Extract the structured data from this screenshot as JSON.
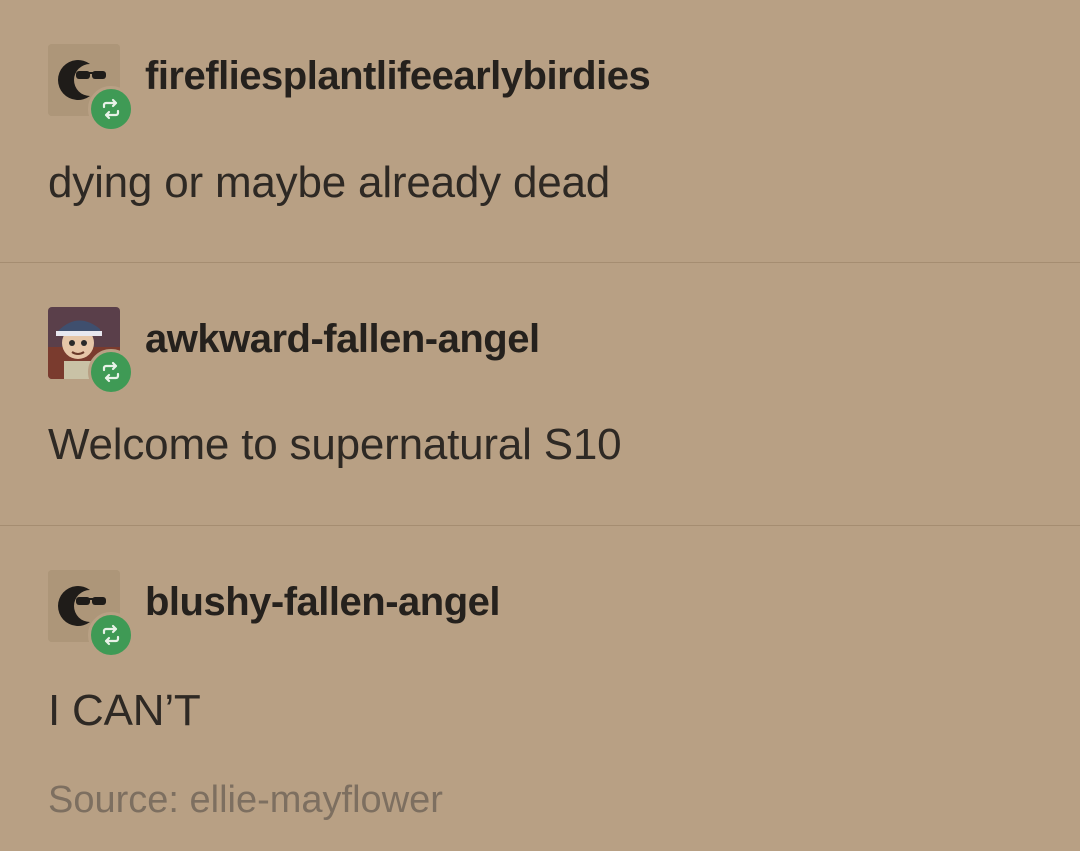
{
  "posts": [
    {
      "username": "firefliesplantlifeearlybirdies",
      "text": "dying or maybe already dead",
      "avatar_icon": "sunglasses-moon-icon",
      "badge_icon": "reblog-icon"
    },
    {
      "username": "awkward-fallen-angel",
      "text": "Welcome to supernatural S10",
      "avatar_icon": "cartoon-character-avatar",
      "badge_icon": "reblog-icon"
    },
    {
      "username": "blushy-fallen-angel",
      "text": "I CAN’T",
      "avatar_icon": "sunglasses-moon-icon",
      "badge_icon": "reblog-icon"
    }
  ],
  "source": {
    "label": "Source: ellie-mayflower"
  },
  "colors": {
    "background": "#b8a084",
    "reblog_badge": "#3f9a55",
    "text": "#2e2924",
    "source_text": "#7d6f60"
  }
}
